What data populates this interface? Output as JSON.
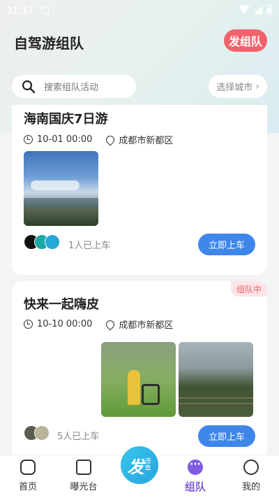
{
  "status": {
    "time": "11:17"
  },
  "header": {
    "title": "自驾游组队",
    "post_label": "发组队"
  },
  "search": {
    "placeholder": "搜索组队活动",
    "city_label": "选择城市"
  },
  "cards": [
    {
      "title": "海南国庆7日游",
      "datetime": "10-01 00:00",
      "location": "成都市新都区",
      "joined": "1人已上车",
      "button": "立即上车"
    },
    {
      "title": "快来一起嗨皮",
      "badge": "组队中",
      "datetime": "10-10 00:00",
      "location": "成都市新都区",
      "joined": "5人已上车",
      "button": "立即上车"
    }
  ],
  "fab": {
    "label": "发",
    "sub": "违章"
  },
  "tabs": [
    {
      "label": "首页",
      "icon": "home-icon"
    },
    {
      "label": "曝光台",
      "icon": "exposure-icon"
    },
    {
      "label": "组队",
      "icon": "chat-bubble-icon"
    },
    {
      "label": "我的",
      "icon": "smile-icon"
    }
  ],
  "colors": {
    "accent": "#3f86ea",
    "post": "#f2626a",
    "tab_active": "#7f5ce0",
    "badge": "#e9626b"
  }
}
